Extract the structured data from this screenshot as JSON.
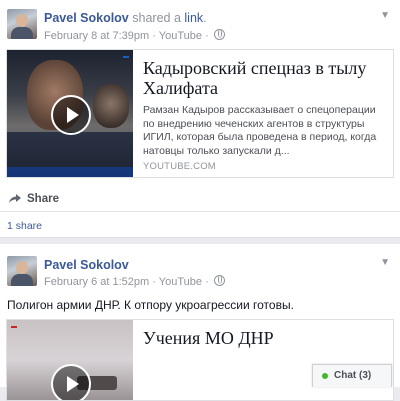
{
  "posts": [
    {
      "author": "Pavel Sokolov",
      "action_prefix": "shared a",
      "action_link": "link",
      "action_suffix": ".",
      "timestamp": "February 8 at 7:39pm",
      "separator": "·",
      "source": "YouTube",
      "privacy_icon": "globe-icon",
      "card": {
        "title": "Кадыровский спецназ в тылу Халифата",
        "description": "Рамзан Кадыров рассказывает о спецоперации по внедрению чеченских агентов в структуры ИГИЛ, которая была проведена в период, когда натовцы только запускали д...",
        "domain": "YOUTUBE.COM"
      },
      "share_label": "Share",
      "share_count": "1 share"
    },
    {
      "author": "Pavel Sokolov",
      "timestamp": "February 6 at 1:52pm",
      "separator": "·",
      "source": "YouTube",
      "privacy_icon": "globe-icon",
      "text": "Полигон армии ДНР. К отпору укроагрессии готовы.",
      "card": {
        "title": "Учения МО ДНР"
      }
    }
  ],
  "chat": {
    "label": "Chat (3)"
  },
  "colors": {
    "link": "#3b5998",
    "muted": "#90949c",
    "online": "#42b72a"
  }
}
